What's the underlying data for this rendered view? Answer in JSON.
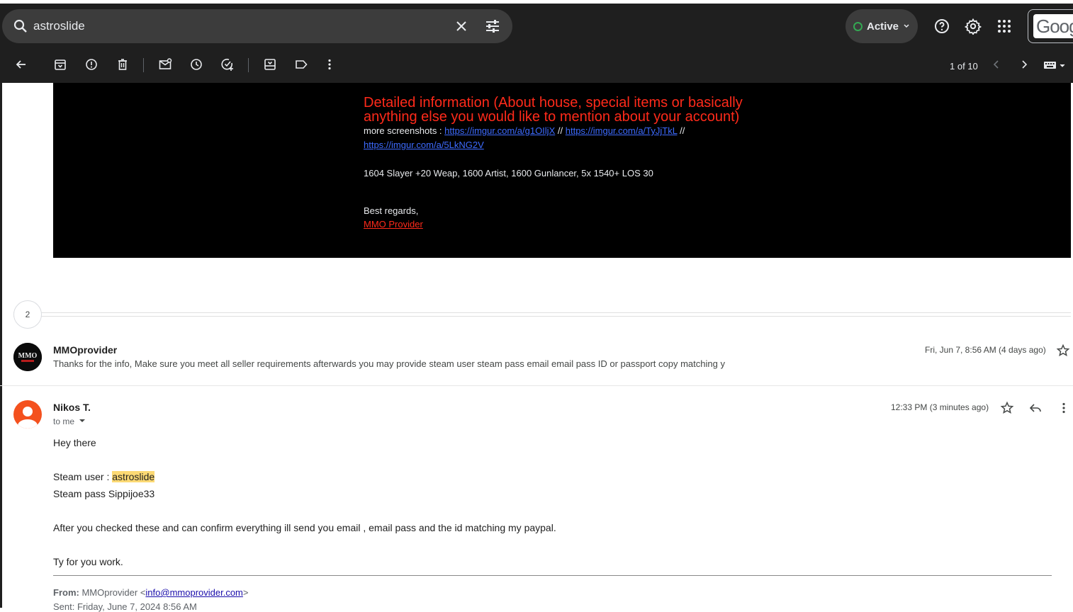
{
  "search": {
    "query": "astroslide"
  },
  "status": {
    "label": "Active"
  },
  "account": {
    "logo_text": "Goog"
  },
  "pager": {
    "text": "1 of 10"
  },
  "message_body": {
    "heading": "Detailed information (About house, special items or basically anything else you would like to mention about your account)",
    "screenshots_label": "more screenshots :",
    "link1": "https://imgur.com/a/g1OIljX",
    "sep1": "//",
    "link2": "https://imgur.com/a/TyJjTkL",
    "sep2": "//",
    "link3": "https://imgur.com/a/5LkNG2V",
    "details": "1604 Slayer +20 Weap, 1600 Artist, 1600 Gunlancer, 5x 1540+ LOS 30",
    "closing": "Best regards,",
    "signature": "MMO Provider"
  },
  "collapsed_count": "2",
  "collapsed_message": {
    "sender": "MMOprovider",
    "avatar_text": "MMO",
    "snippet": "Thanks for the info, Make sure you meet all seller requirements afterwards you may provide steam user steam pass email email pass ID or passport copy matching y",
    "date": "Fri, Jun 7, 8:56 AM (4 days ago)"
  },
  "open_message": {
    "sender": "Nikos T.",
    "to": "to me",
    "date": "12:33 PM (3 minutes ago)",
    "greeting": "Hey there",
    "steam_user_label": "Steam user :",
    "steam_user_value": "astroslide",
    "steam_pass": "Steam pass Sippijoe33",
    "paragraph": "After you checked these and can confirm everything ill send you email , email pass and the id matching my paypal.",
    "thanks": "Ty for you work.",
    "quoted_from_label": "From:",
    "quoted_from_name": "MMOprovider <",
    "quoted_from_email": "info@mmoprovider.com",
    "quoted_from_end": ">",
    "quoted_sent": "Sent: Friday, June 7, 2024 8:56 AM"
  }
}
